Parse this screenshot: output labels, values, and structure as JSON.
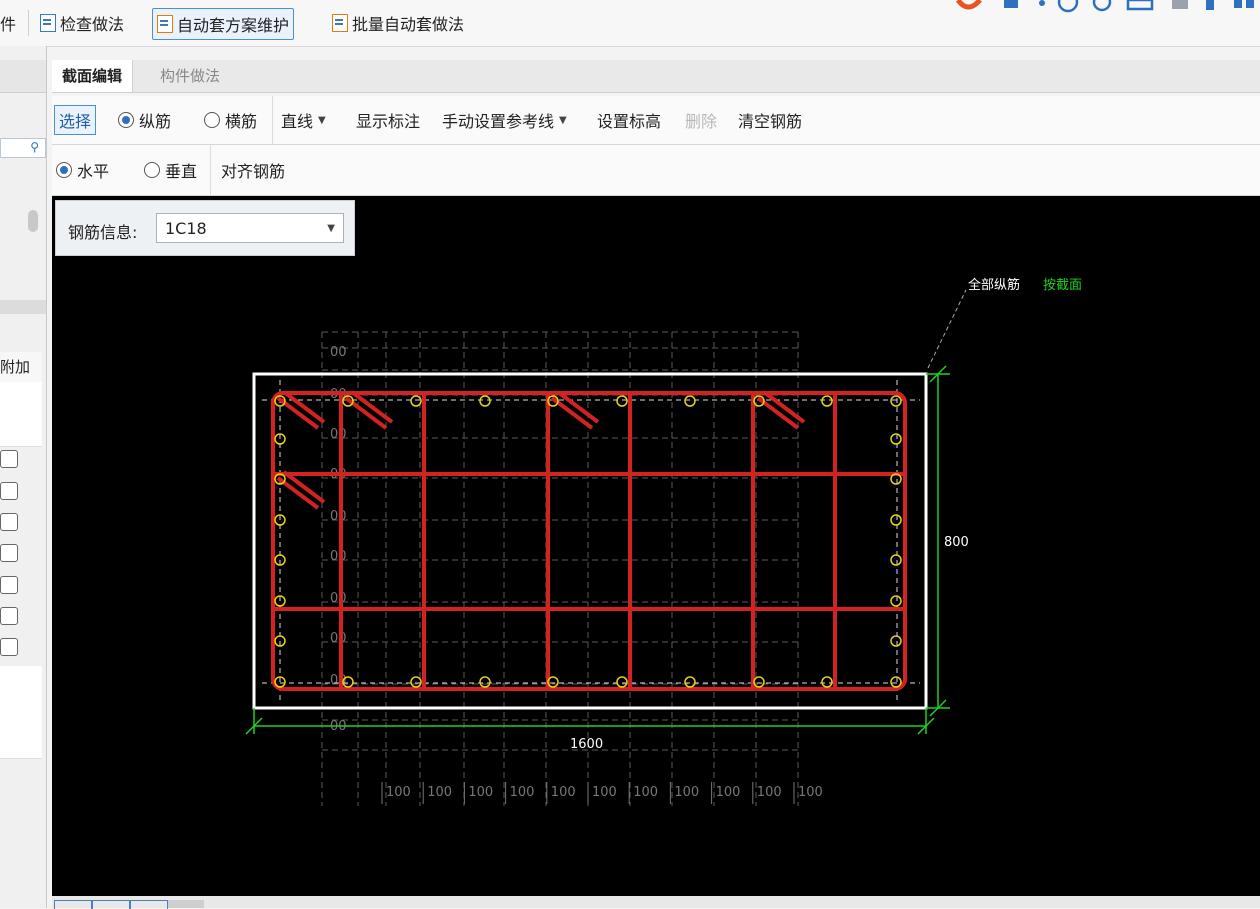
{
  "toolbar": {
    "partial_label": "件",
    "check_method": "检查做法",
    "auto_scheme": "自动套方案维护",
    "batch_auto": "批量自动套做法"
  },
  "left_panel": {
    "column_header": "附加",
    "checkbox_count": 7
  },
  "tabs": [
    {
      "label": "截面编辑",
      "active": true
    },
    {
      "label": "构件做法",
      "active": false
    }
  ],
  "edit_toolbar": {
    "select": "选择",
    "longitudinal": "纵筋",
    "transverse": "横筋",
    "line_type": "直线",
    "show_annotation": "显示标注",
    "manual_ref_line": "手动设置参考线",
    "set_elevation": "设置标高",
    "delete": "删除",
    "clear_rebar": "清空钢筋"
  },
  "align_toolbar": {
    "horizontal": "水平",
    "vertical": "垂直",
    "align_rebar": "对齐钢筋"
  },
  "rebar_info": {
    "label": "钢筋信息:",
    "value": "1C18"
  },
  "drawing": {
    "section_width": "1600",
    "section_height": "800",
    "annotation_white": "全部纵筋",
    "annotation_green": "按截面",
    "grid_labels": [
      "100",
      "100",
      "100",
      "100",
      "100",
      "100",
      "100",
      "100",
      "100",
      "100",
      "100"
    ],
    "side_labels": [
      "00",
      "00",
      "00",
      "00",
      "00",
      "00",
      "00",
      "00",
      "00",
      "00"
    ],
    "colors": {
      "stirrup": "#d32222",
      "rebar_dot": "#e6d21a",
      "dimension": "#1fd11f",
      "section": "#ffffff",
      "grid": "#5a5a5a"
    }
  }
}
